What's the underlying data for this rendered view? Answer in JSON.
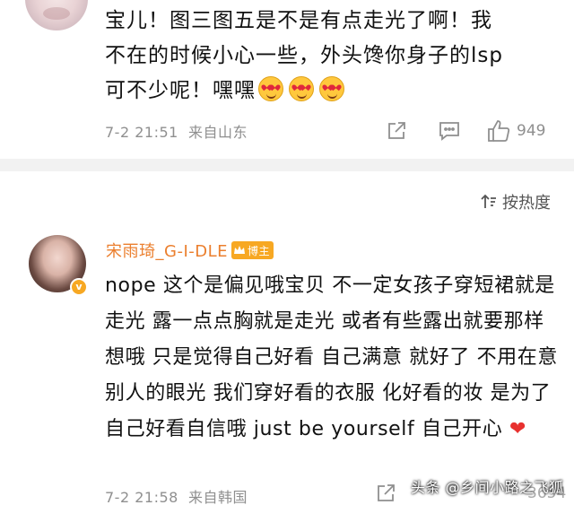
{
  "comment1": {
    "text_line1": "宝儿！图三图五是不是有点走光了啊！我",
    "text_line2": "不在的时候小心一些，外头馋你身子的lsp",
    "text_line3": "可不少呢！嘿嘿",
    "emojis": [
      "heart-eyes-emoji",
      "heart-eyes-emoji",
      "heart-eyes-emoji"
    ],
    "time": "7-2 21:51",
    "location": "来自山东",
    "like_count": "949"
  },
  "sort": {
    "label": "按热度"
  },
  "comment2": {
    "username": "宋雨琦_G-I-DLE",
    "author_badge": "博主",
    "avatar_badge": "v",
    "text": "nope 这个是偏见哦宝贝 不一定女孩子穿短裙就是走光 露一点点胸就是走光 或者有些露出就要那样想哦 只是觉得自己好看 自己满意 就好了 不用在意别人的眼光 我们穿好看的衣服 化好看的妆 是为了自己好看自信哦 just be yourself 自己开心",
    "heart": "❤",
    "time": "7-2 21:58",
    "location": "来自韩国",
    "like_count": "3654"
  },
  "watermark": "头条 @乡间小路之飞狐",
  "colors": {
    "username": "#eb7f2e",
    "badge": "#f7a823",
    "meta": "#8f8f8f",
    "divider": "#f2f2f2",
    "heart": "#e8312f"
  }
}
